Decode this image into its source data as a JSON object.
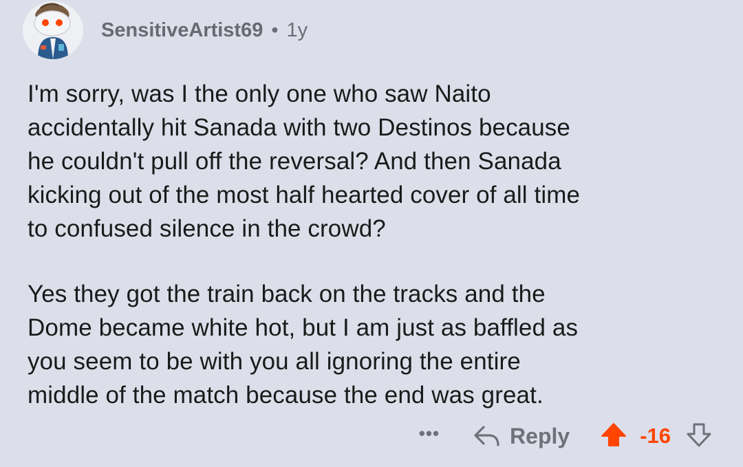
{
  "comment": {
    "username": "SensitiveArtist69",
    "separator": "•",
    "age": "1y",
    "paragraphs": [
      "I'm sorry, was I the only one who saw Naito\naccidentally hit Sanada with two Destinos because\nhe couldn't pull off the reversal? And then Sanada\nkicking out of the most half hearted cover of all time\nto confused silence in the crowd?",
      "Yes they got the train back on the tracks and the\nDome became white hot, but I am just as baffled as\nyou seem to be with you all ignoring the entire\nmiddle of the match because the end was great."
    ]
  },
  "actions": {
    "more_label": "•••",
    "reply_label": "Reply",
    "score": "-16"
  },
  "colors": {
    "background": "#dcdfe9",
    "upvote_active": "#ff4500",
    "muted_text": "#6e717a"
  },
  "icons": {
    "avatar": "reddit-snoo-avatar",
    "reply": "reply-arrow-icon",
    "upvote": "upvote-arrow-icon",
    "downvote": "downvote-arrow-icon",
    "more": "more-options-icon"
  }
}
